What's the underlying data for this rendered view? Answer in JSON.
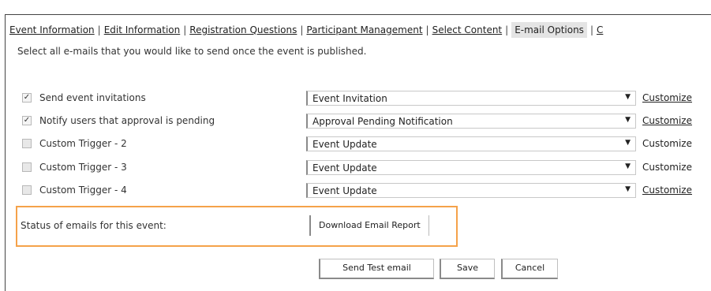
{
  "tabs": [
    {
      "label": "Event Information",
      "active": false
    },
    {
      "label": "Edit Information",
      "active": false
    },
    {
      "label": "Registration Questions",
      "active": false
    },
    {
      "label": "Participant Management",
      "active": false
    },
    {
      "label": "Select Content",
      "active": false
    },
    {
      "label": "E-mail Options",
      "active": true
    },
    {
      "label": "C",
      "active": false
    }
  ],
  "intro": "Select all e-mails that you would like to send once the event is published.",
  "rows": [
    {
      "checked": true,
      "label": "Send event invitations",
      "template": "Event Invitation",
      "customize": "Customize"
    },
    {
      "checked": true,
      "label": "Notify users that approval is pending",
      "template": "Approval Pending Notification",
      "customize": "Customize"
    },
    {
      "checked": false,
      "label": "Custom Trigger - 2",
      "template": "Event Update",
      "customize": "Customize"
    },
    {
      "checked": false,
      "label": "Custom Trigger - 3",
      "template": "Event Update",
      "customize": "Customize"
    },
    {
      "checked": false,
      "label": "Custom Trigger - 4",
      "template": "Event Update",
      "customize": "Customize"
    }
  ],
  "status": {
    "label": "Status of emails for this event:",
    "button": "Download Email Report",
    "highlight_color": "#f5a24a"
  },
  "actions": {
    "send_test": "Send Test email",
    "save": "Save",
    "cancel": "Cancel"
  },
  "icons": {
    "checked": "check-icon",
    "dropdown": "chevron-down-icon"
  }
}
